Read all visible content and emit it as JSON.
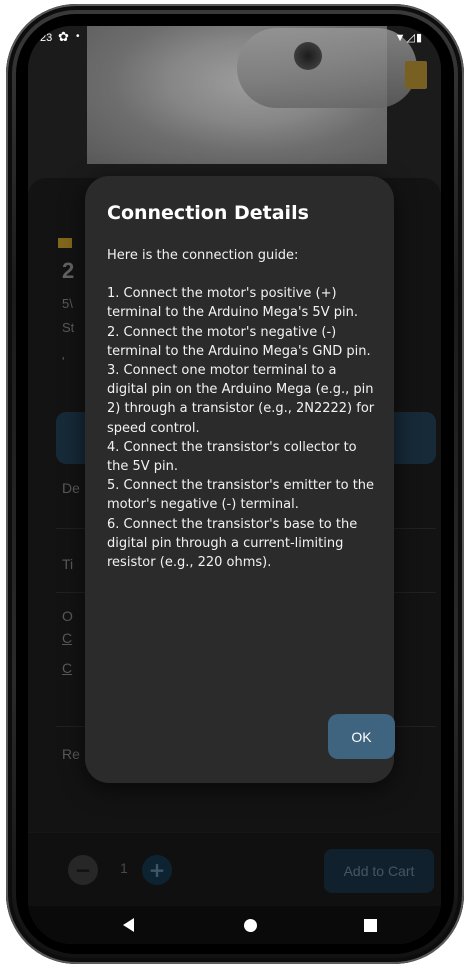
{
  "status_bar": {
    "time": "23",
    "icons": [
      "gear-icon",
      "app-notification-icon",
      "wifi-icon",
      "signal-icon",
      "battery-icon"
    ]
  },
  "background": {
    "title": "2",
    "line1": "5\\",
    "line2": "St",
    "line3": "'",
    "row1": "De",
    "row2": "Ti",
    "row3": "O",
    "row4": "C",
    "row5": "C",
    "row6": "Re"
  },
  "cart_bar": {
    "quantity": "1",
    "add_to_cart_label": "Add to Cart"
  },
  "dialog": {
    "title": "Connection Details",
    "intro": "Here is the connection guide:",
    "steps": [
      "1. Connect the motor's positive (+) terminal to the Arduino Mega's 5V pin.",
      "2. Connect the motor's negative (-) terminal to the Arduino Mega's GND pin.",
      "3. Connect one motor terminal to a digital pin on the Arduino Mega (e.g., pin 2) through a transistor (e.g., 2N2222) for speed control.",
      "4. Connect the transistor's collector to the 5V pin.",
      "5. Connect the transistor's emitter to the motor's negative (-) terminal.",
      "6. Connect the transistor's base to the digital pin through a current-limiting resistor (e.g., 220 ohms)."
    ],
    "ok_label": "OK"
  },
  "colors": {
    "dialog_bg": "#2b2b2b",
    "ok_button": "#3e6480",
    "screen_bg": "#1b1b1b"
  }
}
